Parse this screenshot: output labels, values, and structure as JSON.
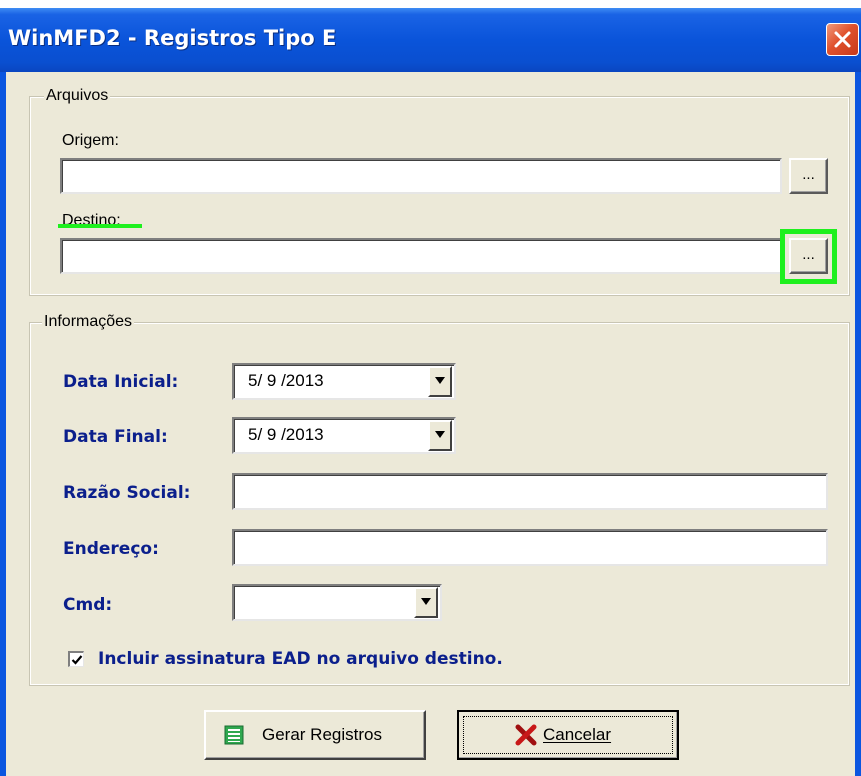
{
  "window": {
    "title": "WinMFD2 - Registros Tipo E",
    "close_icon": "close-icon"
  },
  "arquivos": {
    "legend": "Arquivos",
    "origem_label": "Origem:",
    "origem_value": "",
    "origem_browse": "...",
    "destino_label": "Destino:",
    "destino_value": "",
    "destino_browse": "..."
  },
  "informacoes": {
    "legend": "Informações",
    "data_inicial_label": "Data Inicial:",
    "data_inicial_value": "5/ 9 /2013",
    "data_final_label": "Data Final:",
    "data_final_value": "5/ 9 /2013",
    "razao_social_label": "Razão Social:",
    "razao_social_value": "",
    "endereco_label": "Endereço:",
    "endereco_value": "",
    "cmd_label": "Cmd:",
    "cmd_value": "",
    "checkbox_label": "Incluir assinatura EAD no arquivo destino.",
    "checkbox_checked": true
  },
  "buttons": {
    "gerar_label": "Gerar Registros",
    "gerar_icon": "list-icon",
    "cancelar_label": "Cancelar",
    "cancelar_icon": "x-icon"
  },
  "colors": {
    "titlebar": "#0a54da",
    "dialog_bg": "#ece9d8",
    "bold_label": "#0b1f8c",
    "highlight": "#1ef01e"
  }
}
